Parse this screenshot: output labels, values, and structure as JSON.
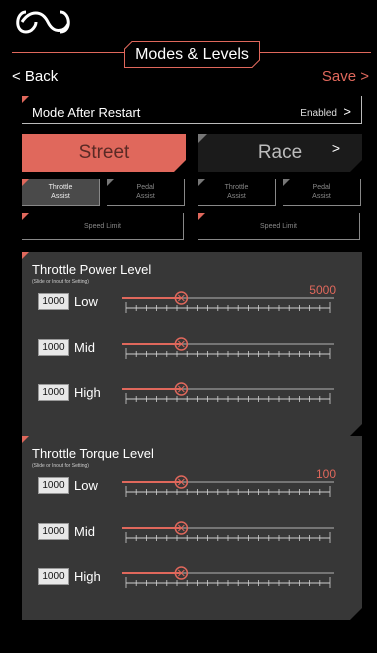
{
  "header": {
    "title": "Modes & Levels",
    "back_label": "< Back",
    "save_label": "Save >"
  },
  "colors": {
    "accent": "#e0685c",
    "panel": "#373737",
    "background": "#000000"
  },
  "mode_after_restart": {
    "label": "Mode After Restart",
    "value": "Enabled",
    "chevron": ">"
  },
  "modes": {
    "street": {
      "label": "Street",
      "selected": true
    },
    "race": {
      "label": "Race",
      "selected": false,
      "chevron": ">"
    }
  },
  "street_options": {
    "throttle_assist": {
      "line1": "Throttle",
      "line2": "Assist",
      "active": true
    },
    "pedal_assist": {
      "line1": "Pedal",
      "line2": "Assist",
      "active": false
    },
    "speed_limit": {
      "label": "Speed Limit"
    }
  },
  "race_options": {
    "throttle_assist": {
      "line1": "Throttle",
      "line2": "Assist",
      "active": false
    },
    "pedal_assist": {
      "line1": "Pedal",
      "line2": "Assist",
      "active": false
    },
    "speed_limit": {
      "label": "Speed Limit"
    }
  },
  "throttle_power": {
    "title": "Throttle Power Level",
    "subtitle": "(Slide or Inout for Setting)",
    "max_value": "5000",
    "levels": [
      {
        "label": "Low",
        "value": "1000",
        "fraction": 0.28
      },
      {
        "label": "Mid",
        "value": "1000",
        "fraction": 0.28
      },
      {
        "label": "High",
        "value": "1000",
        "fraction": 0.28
      }
    ]
  },
  "throttle_torque": {
    "title": "Throttle Torque Level",
    "subtitle": "(Slide or Inout for Setting)",
    "max_value": "100",
    "levels": [
      {
        "label": "Low",
        "value": "1000",
        "fraction": 0.28
      },
      {
        "label": "Mid",
        "value": "1000",
        "fraction": 0.28
      },
      {
        "label": "High",
        "value": "1000",
        "fraction": 0.28
      }
    ]
  }
}
